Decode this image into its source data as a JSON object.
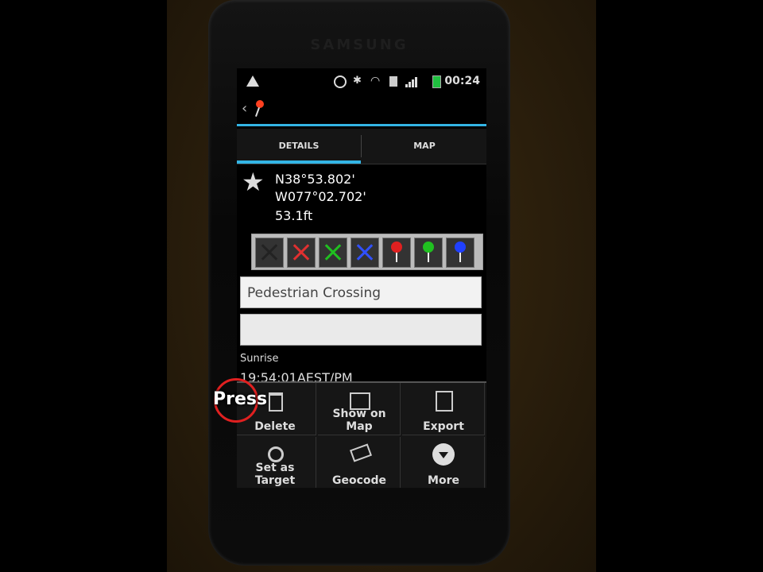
{
  "device": {
    "brand": "SAMSUNG"
  },
  "status_bar": {
    "time": "00:24"
  },
  "tabs": [
    {
      "label": "DETAILS"
    },
    {
      "label": "MAP"
    }
  ],
  "details": {
    "latitude": "N38°53.802'",
    "longitude": "W077°02.702'",
    "altitude": "53.1ft",
    "name_value": "Pedestrian Crossing",
    "note_value": "",
    "sunrise_label": "Sunrise",
    "sunrise_value": "19:54:01AEST/PM"
  },
  "icon_strip": [
    {
      "type": "cross",
      "color": "#222222"
    },
    {
      "type": "cross",
      "color": "#e03030"
    },
    {
      "type": "cross",
      "color": "#20c020"
    },
    {
      "type": "cross",
      "color": "#3050ff"
    },
    {
      "type": "pin",
      "color": "#e02020"
    },
    {
      "type": "pin",
      "color": "#20c020"
    },
    {
      "type": "pin",
      "color": "#2040ff"
    }
  ],
  "menu": {
    "items": [
      {
        "label": "Delete",
        "icon": "trash-icon"
      },
      {
        "label": "Show on Map",
        "icon": "map-icon"
      },
      {
        "label": "Export",
        "icon": "export-icon"
      },
      {
        "label": "Set as Target",
        "icon": "target-icon"
      },
      {
        "label": "Geocode",
        "icon": "geocode-icon"
      },
      {
        "label": "More",
        "icon": "more-icon"
      }
    ]
  },
  "overlay": {
    "label": "Press"
  },
  "colors": {
    "accent": "#33b5e5",
    "highlight_ring": "#e02020"
  }
}
